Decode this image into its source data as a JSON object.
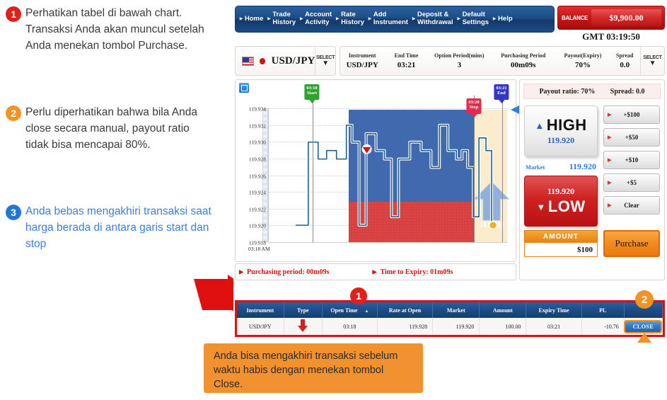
{
  "notes": [
    {
      "num": "1",
      "color": "red",
      "text": "Perhatikan tabel di bawah chart. Transaksi Anda akan muncul setelah Anda menekan tombol Purchase."
    },
    {
      "num": "2",
      "color": "orange",
      "text": "Perlu diperhatikan bahwa bila Anda close secara manual, payout ratio tidak bisa mencapai 80%."
    },
    {
      "num": "3",
      "color": "blue",
      "text": "Anda bebas mengakhiri transaksi saat harga berada di antara garis start dan stop"
    }
  ],
  "nav": {
    "items": [
      {
        "label": "Home",
        "single": true
      },
      {
        "label": "Trade\nHistory",
        "single": false
      },
      {
        "label": "Account\nActivity",
        "single": false
      },
      {
        "label": "Rate\nHistory",
        "single": false
      },
      {
        "label": "Add\nInstrument",
        "single": false
      },
      {
        "label": "Deposit &\nWithdrawal",
        "single": false
      },
      {
        "label": "Default\nSettings",
        "single": false
      },
      {
        "label": "Help",
        "single": true
      }
    ]
  },
  "balance": {
    "label": "BALANCE",
    "value": "$9,900.00"
  },
  "clock": "GMT 03:19:50",
  "instrument_select": {
    "name": "USD/JPY",
    "select_label": "SELECT",
    "caret": "▼"
  },
  "instrument_info": {
    "select_label": "SELECT",
    "caret": "▼",
    "columns": [
      {
        "header": "Instrument",
        "value": "USD/JPY"
      },
      {
        "header": "End Time",
        "value": "03:21"
      },
      {
        "header": "Option Period(mins)",
        "value": "3"
      },
      {
        "header": "Purchasing Period",
        "value": "00m09s"
      },
      {
        "header": "Payout(Expiry)",
        "value": "70%"
      },
      {
        "header": "Spread",
        "value": "0.0"
      }
    ]
  },
  "chart_data": {
    "type": "line",
    "title": "",
    "xlabel": "",
    "ylabel": "",
    "ylim": [
      119.918,
      119.934
    ],
    "yticks": [
      "119.934",
      "119.932",
      "119.930",
      "119.928",
      "119.926",
      "119.924",
      "119.922",
      "119.920",
      "119.918"
    ],
    "xticks": [
      "03:18 AM"
    ],
    "grid": true,
    "markers": [
      {
        "id": "start",
        "time": "03:18",
        "label": "Start",
        "color": "#2ea32e"
      },
      {
        "id": "stop",
        "time": "03:20",
        "label": "Stop",
        "color": "#e52a4e"
      },
      {
        "id": "end",
        "time": "03:21",
        "label": "End",
        "color": "#3636c7"
      }
    ],
    "zones": {
      "high_label": "HIGH",
      "low_label": "LOW",
      "strike": 119.92,
      "high_color": "#4169ad",
      "low_color": "#d94040",
      "future_color": "#fbeccd"
    },
    "series": [
      {
        "name": "USD/JPY",
        "color": "#1f5f8f",
        "x": [
          0,
          2,
          4,
          6,
          8,
          10,
          12,
          14,
          16,
          18,
          20,
          22,
          24,
          26,
          28,
          30,
          32,
          34,
          36,
          38,
          40,
          42,
          44,
          46,
          48,
          50,
          52,
          54,
          56,
          58,
          60,
          62,
          64,
          66,
          68,
          70,
          72,
          74,
          76,
          78,
          80,
          82,
          84,
          86,
          88
        ],
        "y": [
          119.92,
          119.92,
          119.92,
          119.92,
          119.928,
          119.928,
          119.928,
          119.927,
          119.926,
          119.926,
          119.927,
          119.927,
          119.926,
          119.931,
          119.928,
          119.92,
          119.927,
          119.93,
          119.928,
          119.927,
          119.921,
          119.927,
          119.927,
          119.928,
          119.928,
          119.928,
          119.926,
          119.926,
          119.93,
          119.926,
          119.927,
          119.927,
          119.926,
          119.928,
          119.929,
          119.922,
          119.928,
          119.928,
          119.92
        ]
      }
    ]
  },
  "period_bar": {
    "purchasing": "Purchasing period: 00m09s",
    "expiry": "Time to Expiry: 01m09s"
  },
  "trade_panel": {
    "payout_ratio": "Payout ratio:  70%",
    "spread": "Spread: 0.0",
    "high": {
      "label": "HIGH",
      "price": "119.920",
      "caret": "▲"
    },
    "low": {
      "label": "LOW",
      "price": "119.920",
      "caret": "▼"
    },
    "market": {
      "label": "Market",
      "value": "119.920"
    },
    "step_buttons": [
      "+$100",
      "+$50",
      "+$10",
      "+$5",
      "Clear"
    ],
    "amount": {
      "header": "AMOUNT",
      "value": "$100"
    },
    "purchase_label": "Purchase"
  },
  "transactions": {
    "headers": [
      "Instrument",
      "Type",
      "Open Time",
      "Rate at Open",
      "Market",
      "Amount",
      "Expiry Time",
      "PL",
      ""
    ],
    "sort_caret": "▲",
    "rows": [
      {
        "instrument": "USD/JPY",
        "type": "⬇",
        "open_time": "03:18",
        "rate_at_open": "119.928",
        "market": "119.920",
        "amount": "100.00",
        "expiry_time": "03:21",
        "pl": "-10.76",
        "close_label": "CLOSE"
      }
    ]
  },
  "annotations": {
    "badge1": "1",
    "badge2": "2",
    "badge3": "3"
  },
  "callout": {
    "text": "Anda bisa mengakhiri transaksi sebelum waktu habis dengan menekan tombol Close."
  }
}
